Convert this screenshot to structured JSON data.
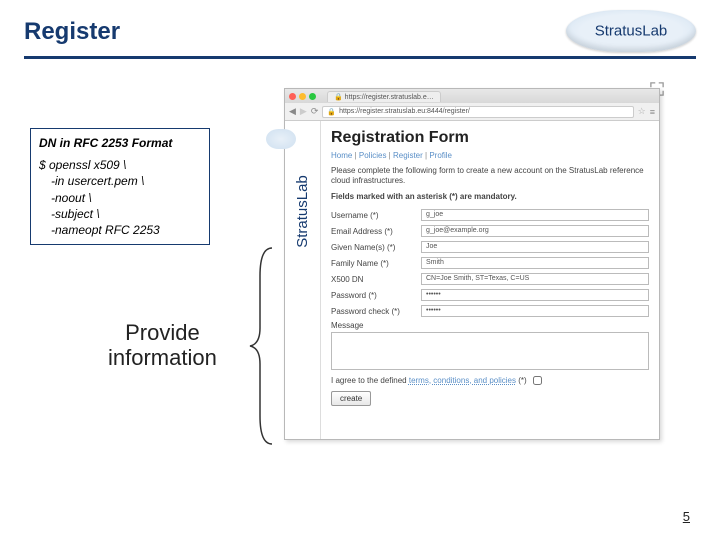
{
  "slide": {
    "title": "Register",
    "logo_text": "StratusLab",
    "page_number": "5"
  },
  "dn_box": {
    "title": "DN in RFC 2253 Format",
    "line1": "$ openssl x509 \\",
    "line2": "-in usercert.pem \\",
    "line3": "-noout \\",
    "line4": "-subject \\",
    "line5": "-nameopt RFC 2253"
  },
  "callout": {
    "provide_line1": "Provide",
    "provide_line2": "information"
  },
  "browser": {
    "tab_label": "https://register.stratuslab.e…",
    "url": "https://register.stratuslab.eu:8444/register/",
    "vlogo": "StratusLab",
    "h1": "Registration Form",
    "nav_home": "Home",
    "nav_policies": "Policies",
    "nav_register": "Register",
    "nav_profile": "Profile",
    "intro": "Please complete the following form to create a new account on the StratusLab reference cloud infrastructures.",
    "mandatory": "Fields marked with an asterisk (*) are mandatory.",
    "form": {
      "username_label": "Username (*)",
      "username_value": "g_joe",
      "email_label": "Email Address (*)",
      "email_value": "g_joe@example.org",
      "given_label": "Given Name(s) (*)",
      "given_value": "Joe",
      "family_label": "Family Name (*)",
      "family_value": "Smith",
      "x500_label": "X500 DN",
      "x500_value": "CN=Joe Smith, ST=Texas, C=US",
      "password_label": "Password (*)",
      "password_value": "••••••",
      "password2_label": "Password check (*)",
      "password2_value": "••••••",
      "message_label": "Message",
      "agree_prefix": "I agree to the defined ",
      "agree_link": "terms, conditions, and policies",
      "agree_suffix": " (*)",
      "create_button": "create"
    }
  }
}
